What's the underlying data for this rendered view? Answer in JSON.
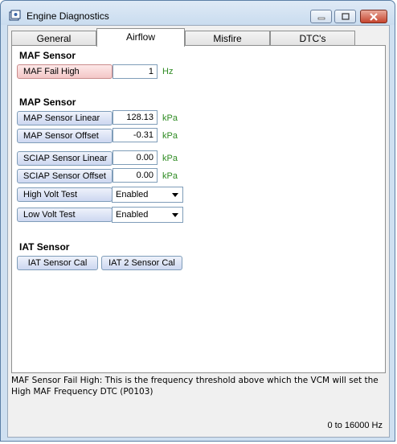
{
  "window": {
    "title": "Engine Diagnostics",
    "controls": {
      "minimize": "minimize",
      "maximize": "maximize",
      "close": "close"
    }
  },
  "tabs": [
    {
      "label": "General",
      "active": false
    },
    {
      "label": "Airflow",
      "active": true
    },
    {
      "label": "Misfire",
      "active": false
    },
    {
      "label": "DTC's",
      "active": false
    }
  ],
  "maf": {
    "heading": "MAF Sensor",
    "fail_high": {
      "label": "MAF Fail High",
      "value": "1",
      "unit": "Hz"
    }
  },
  "map": {
    "heading": "MAP Sensor",
    "linear": {
      "label": "MAP Sensor Linear",
      "value": "128.13",
      "unit": "kPa"
    },
    "offset": {
      "label": "MAP Sensor Offset",
      "value": "-0.31",
      "unit": "kPa"
    },
    "sciap_linear": {
      "label": "SCIAP Sensor Linear",
      "value": "0.00",
      "unit": "kPa"
    },
    "sciap_offset": {
      "label": "SCIAP Sensor Offset",
      "value": "0.00",
      "unit": "kPa"
    },
    "high_volt": {
      "label": "High Volt Test",
      "value": "Enabled"
    },
    "low_volt": {
      "label": "Low Volt Test",
      "value": "Enabled"
    }
  },
  "iat": {
    "heading": "IAT Sensor",
    "cal_button": "IAT Sensor Cal",
    "cal2_button": "IAT 2 Sensor Cal"
  },
  "status": {
    "description": "MAF Sensor Fail High: This is the frequency threshold above which the VCM will set the High MAF Frequency DTC (P0103)",
    "range": "0 to 16000 Hz"
  },
  "colors": {
    "unit_text": "#2e8b22",
    "alert_field": "#f3c7c7",
    "close_button": "#c6452f"
  }
}
